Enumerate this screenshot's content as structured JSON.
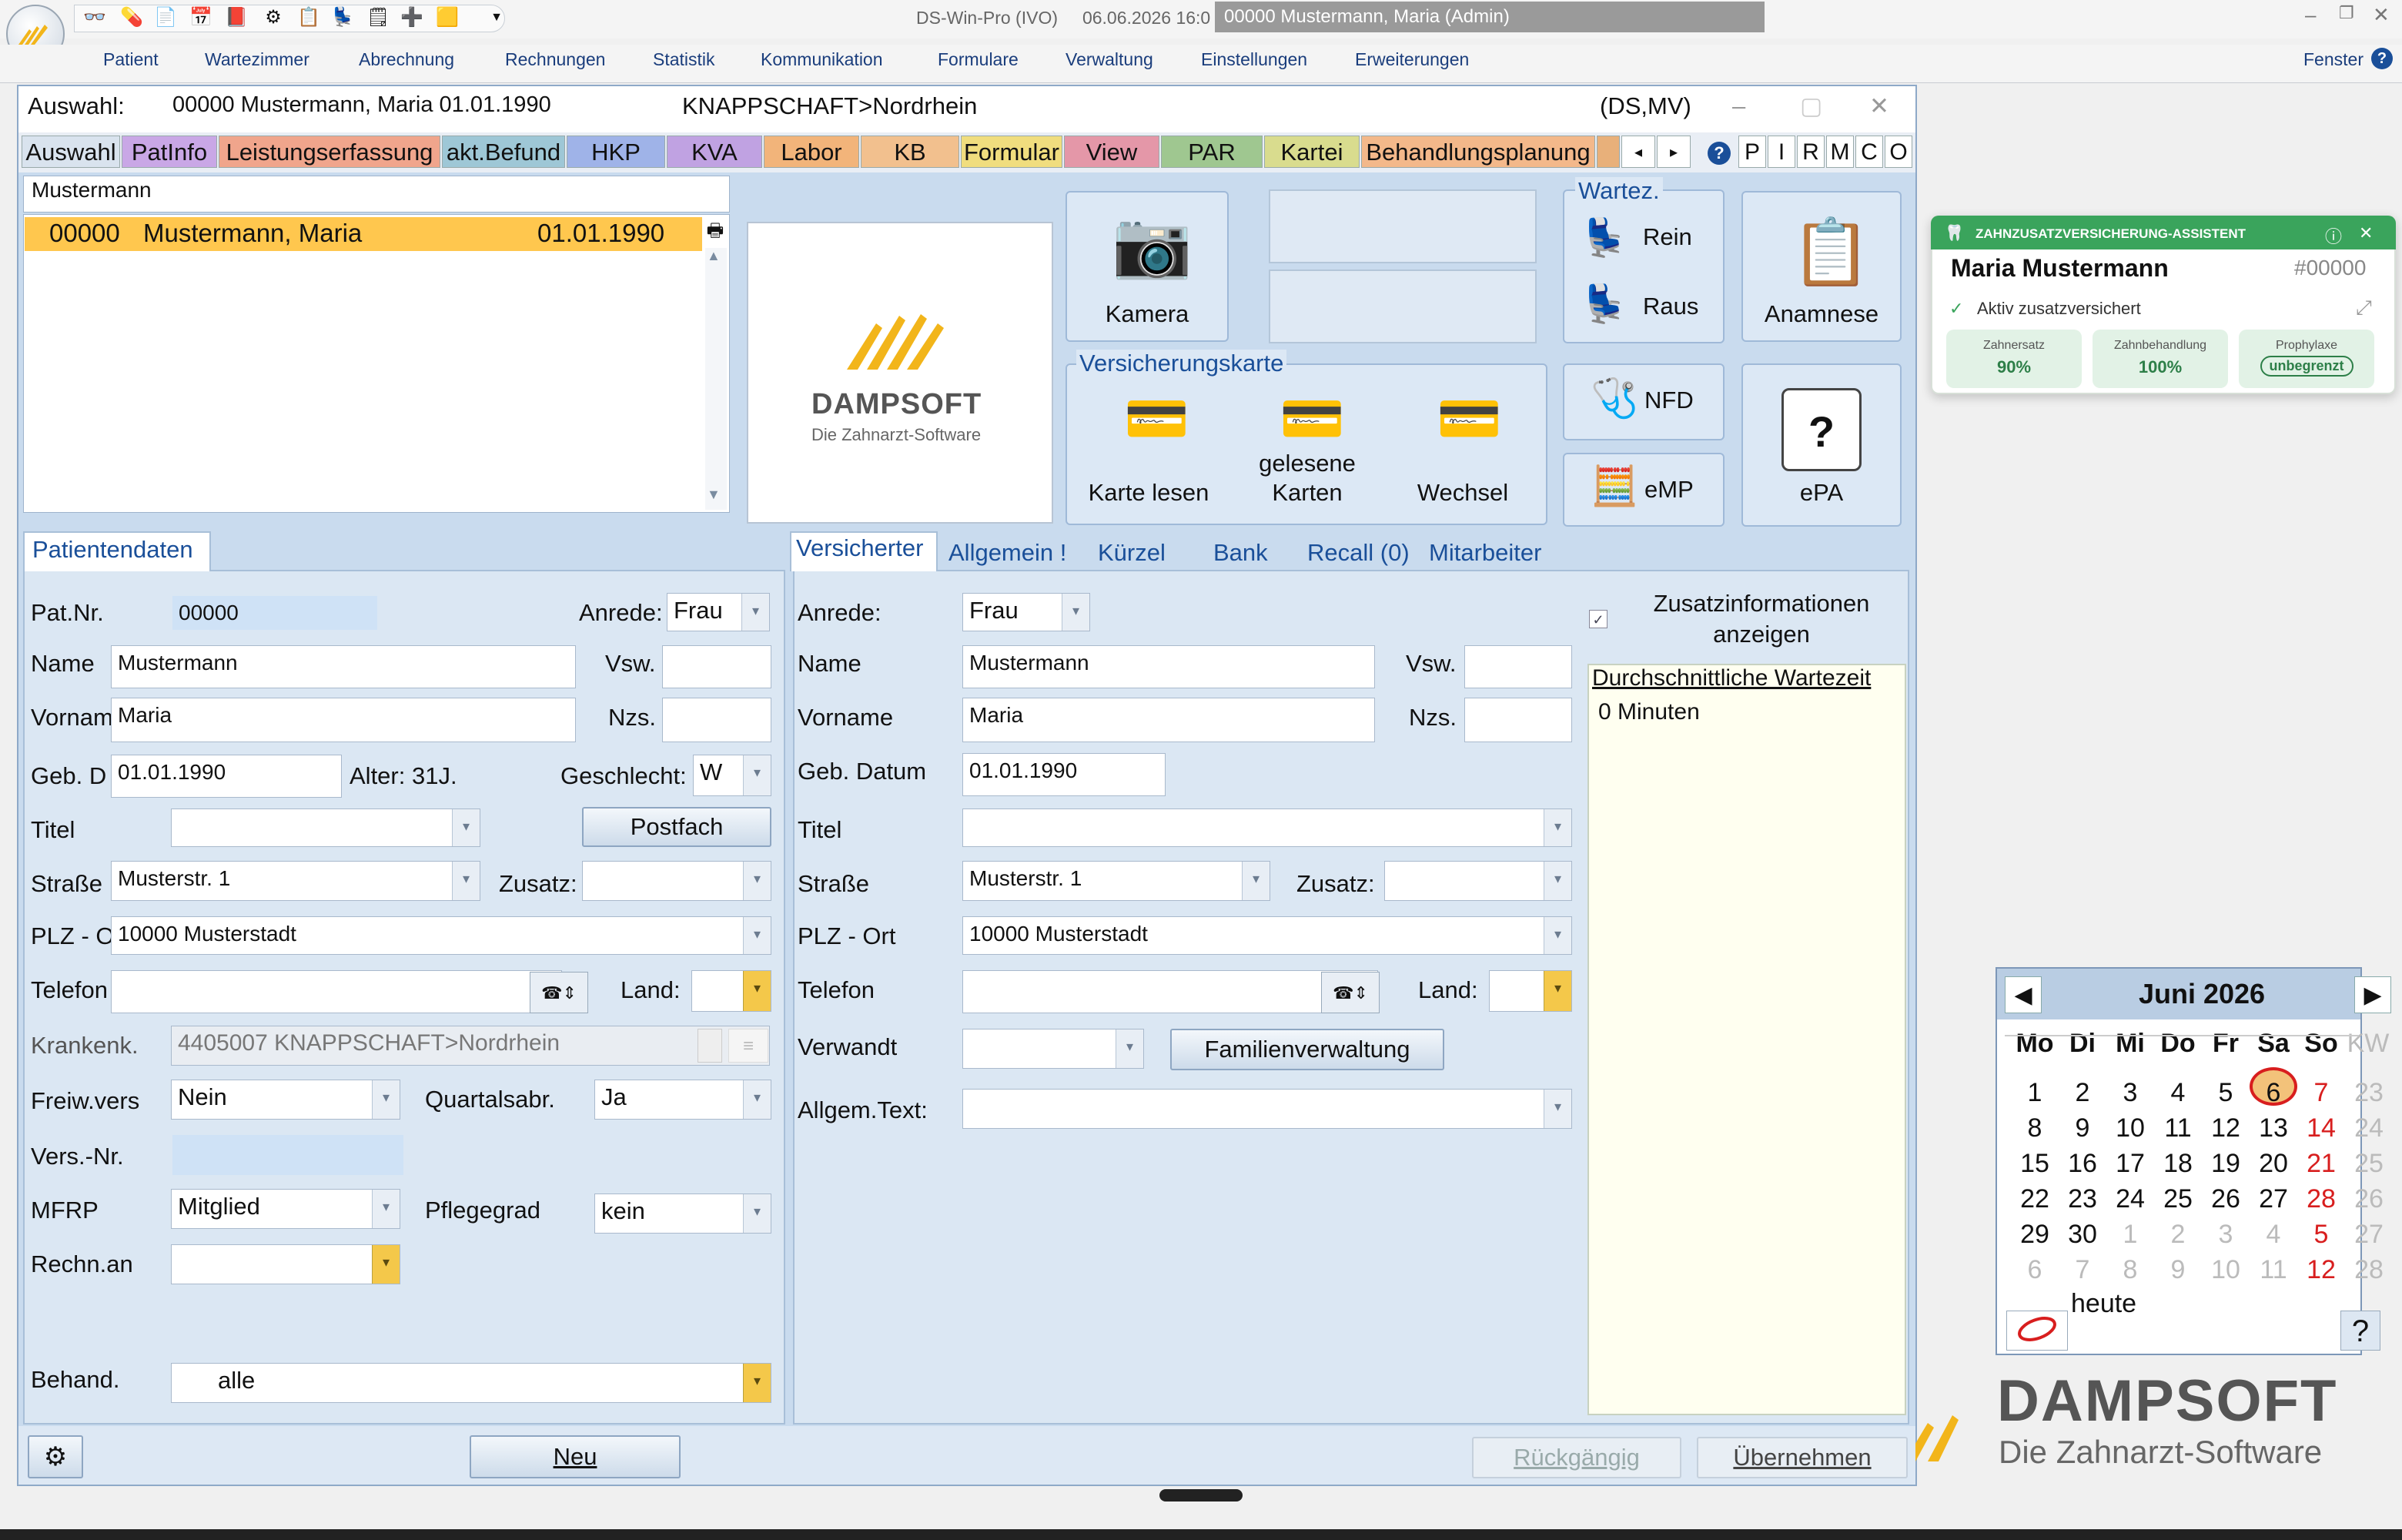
{
  "window": {
    "app_title": "DS-Win-Pro (IVO)",
    "date_time": "06.06.2026   16:0",
    "patient_banner": "00000 Mustermann, Maria  (Admin)",
    "fenster": "Fenster"
  },
  "menu": [
    "Patient",
    "Wartezimmer",
    "Abrechnung",
    "Rechnungen",
    "Statistik",
    "Kommunikation",
    "Formulare",
    "Verwaltung",
    "Einstellungen",
    "Erweiterungen"
  ],
  "selection_header": {
    "label": "Auswahl:",
    "patient": "00000  Mustermann, Maria  01.01.1990",
    "insurance": "KNAPPSCHAFT>Nordrhein",
    "code": "(DS,MV)"
  },
  "tabs": [
    {
      "label": "Auswahl",
      "color": "#d9e3ee"
    },
    {
      "label": "PatInfo",
      "color": "#c9a7e6"
    },
    {
      "label": "Leistungserfassung",
      "color": "#f0a58c"
    },
    {
      "label": "akt.Befund",
      "color": "#9ec7d6"
    },
    {
      "label": "HKP",
      "color": "#9fb3e8"
    },
    {
      "label": "KVA",
      "color": "#c0a2e2"
    },
    {
      "label": "Labor",
      "color": "#f2b47a"
    },
    {
      "label": "KB",
      "color": "#f2c08e"
    },
    {
      "label": "Formular",
      "color": "#f0dd7e"
    },
    {
      "label": "View",
      "color": "#e497a8"
    },
    {
      "label": "PAR",
      "color": "#9fc790"
    },
    {
      "label": "Kartei",
      "color": "#d9dc8e"
    },
    {
      "label": "Behandlungsplanung",
      "color": "#f3b88a"
    }
  ],
  "tab_letters": [
    "P",
    "I",
    "R",
    "M",
    "C",
    "O"
  ],
  "search_text": "Mustermann",
  "patient_row": {
    "nr": "00000",
    "name": "Mustermann, Maria",
    "dob": "01.01.1990"
  },
  "logo": {
    "brand": "DAMPSOFT",
    "tagline": "Die Zahnarzt-Software"
  },
  "tools": {
    "camera": "Kamera",
    "wartez": "Wartez.",
    "rein": "Rein",
    "raus": "Raus",
    "anamnese": "Anamnese",
    "vk_title": "Versicherungskarte",
    "karte_lesen": "Karte lesen",
    "gelesene": "gelesene",
    "karten": "Karten",
    "wechsel": "Wechsel",
    "nfd": "NFD",
    "emp": "eMP",
    "epa": "ePA"
  },
  "assistant": {
    "title": "ZAHNZUSATZVERSICHERUNG-ASSISTENT",
    "name": "Maria Mustermann",
    "id": "#00000",
    "status": "Aktiv zusatzversichert",
    "pills": [
      {
        "label": "Zahnersatz",
        "value": "90%"
      },
      {
        "label": "Zahnbehandlung",
        "value": "100%"
      },
      {
        "label": "Prophylaxe",
        "value": "unbegrenzt"
      }
    ]
  },
  "calendar": {
    "month": "Juni 2026",
    "headers": [
      "Mo",
      "Di",
      "Mi",
      "Do",
      "Fr",
      "Sa",
      "So",
      "KW"
    ],
    "weeks": [
      [
        "1",
        "2",
        "3",
        "4",
        "5",
        "6",
        "7",
        "23"
      ],
      [
        "8",
        "9",
        "10",
        "11",
        "12",
        "13",
        "14",
        "24"
      ],
      [
        "15",
        "16",
        "17",
        "18",
        "19",
        "20",
        "21",
        "25"
      ],
      [
        "22",
        "23",
        "24",
        "25",
        "26",
        "27",
        "28",
        "26"
      ],
      [
        "29",
        "30",
        "1",
        "2",
        "3",
        "4",
        "5",
        "27"
      ],
      [
        "6",
        "7",
        "8",
        "9",
        "10",
        "11",
        "12",
        "28"
      ]
    ],
    "today_label": "heute",
    "help": "?"
  },
  "patientendaten": {
    "tab": "Patientendaten",
    "patnr_label": "Pat.Nr.",
    "patnr": "00000",
    "anrede_label": "Anrede:",
    "anrede": "Frau",
    "name_label": "Name",
    "name": "Mustermann",
    "vsw_label": "Vsw.",
    "vorname_label": "Vornam",
    "vorname": "Maria",
    "nzs_label": "Nzs.",
    "geb_label": "Geb. D",
    "geb": "01.01.1990",
    "alter": "Alter: 31J.",
    "geschlecht_label": "Geschlecht:",
    "geschlecht": "W",
    "titel_label": "Titel",
    "postfach": "Postfach",
    "strasse_label": "Straße",
    "strasse": "Musterstr. 1",
    "zusatz_label": "Zusatz:",
    "plz_label": "PLZ - O",
    "plz": "10000 Musterstadt",
    "telefon_label": "Telefon",
    "land_label": "Land:",
    "krankenk_label": "Krankenk.",
    "krankenk": "4405007 KNAPPSCHAFT>Nordrhein",
    "freiw_label": "Freiw.vers",
    "freiw": "Nein",
    "quartal_label": "Quartalsabr.",
    "quartal": "Ja",
    "versnr_label": "Vers.-Nr.",
    "mfrp_label": "MFRP",
    "mfrp": "Mitglied",
    "pflege_label": "Pflegegrad",
    "pflege": "kein",
    "rechn_label": "Rechn.an",
    "behand_label": "Behand.",
    "behand": "alle"
  },
  "versicherter": {
    "tabs": [
      "Versicherter",
      "Allgemein !",
      "Kürzel",
      "Bank",
      "Recall (0)",
      "Mitarbeiter"
    ],
    "anrede_label": "Anrede:",
    "anrede": "Frau",
    "name_label": "Name",
    "name": "Mustermann",
    "vsw_label": "Vsw.",
    "vorname_label": "Vorname",
    "vorname": "Maria",
    "nzs_label": "Nzs.",
    "geb_label": "Geb. Datum",
    "geb": "01.01.1990",
    "titel_label": "Titel",
    "strasse_label": "Straße",
    "strasse": "Musterstr. 1",
    "zusatz_label": "Zusatz:",
    "plz_label": "PLZ - Ort",
    "plz": "10000 Musterstadt",
    "telefon_label": "Telefon",
    "land_label": "Land:",
    "verwandt_label": "Verwandt",
    "familie": "Familienverwaltung",
    "allgem_label": "Allgem.Text:",
    "zusatzinfo_1": "Zusatzinformationen",
    "zusatzinfo_2": "anzeigen",
    "wartezeit_title": "Durchschnittliche Wartezeit",
    "wartezeit": "0 Minuten"
  },
  "bottom": {
    "neu": "Neu",
    "rueck": "Rückgängig",
    "ueber": "Übernehmen"
  },
  "desktop_logo": {
    "brand": "DAMPSOFT",
    "tagline": "Die Zahnarzt-Software"
  },
  "colors": {
    "accent": "#1a4f99",
    "selected_row": "#ffc74e",
    "assistant": "#3aa45c"
  }
}
